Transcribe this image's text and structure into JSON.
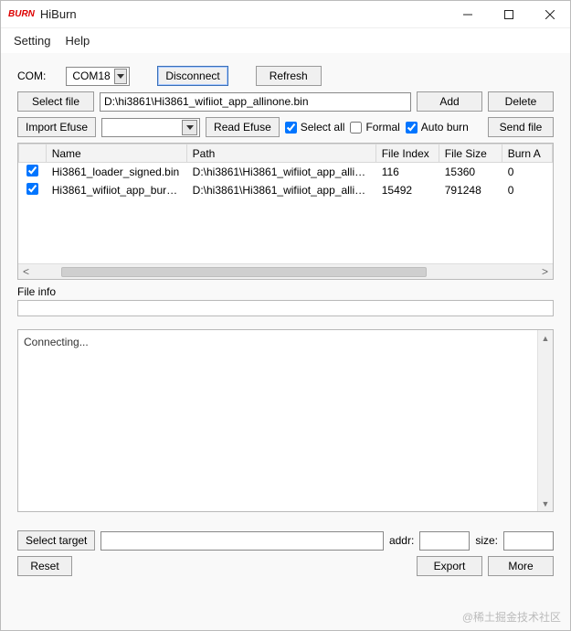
{
  "window": {
    "logo_text": "BURN",
    "title": "HiBurn"
  },
  "menu": {
    "setting": "Setting",
    "help": "Help"
  },
  "com": {
    "label": "COM:",
    "value": "COM18"
  },
  "buttons": {
    "disconnect": "Disconnect",
    "refresh": "Refresh",
    "select_file": "Select file",
    "add": "Add",
    "delete": "Delete",
    "import_efuse": "Import Efuse",
    "read_efuse": "Read Efuse",
    "send_file": "Send file",
    "select_target": "Select target",
    "reset": "Reset",
    "export": "Export",
    "more": "More"
  },
  "file_path": "D:\\hi3861\\Hi3861_wifiiot_app_allinone.bin",
  "checks": {
    "select_all": {
      "label": "Select all",
      "checked": true
    },
    "formal": {
      "label": "Formal",
      "checked": false
    },
    "auto_burn": {
      "label": "Auto burn",
      "checked": true
    }
  },
  "efuse_value": "",
  "table": {
    "headers": {
      "check": "",
      "name": "Name",
      "path": "Path",
      "file_index": "File Index",
      "file_size": "File Size",
      "burn_addr": "Burn A"
    },
    "rows": [
      {
        "checked": true,
        "name": "Hi3861_loader_signed.bin",
        "path": "D:\\hi3861\\Hi3861_wifiiot_app_allinon...",
        "file_index": "116",
        "file_size": "15360",
        "burn_addr": "0"
      },
      {
        "checked": true,
        "name": "Hi3861_wifiiot_app_burn...",
        "path": "D:\\hi3861\\Hi3861_wifiiot_app_allinon...",
        "file_index": "15492",
        "file_size": "791248",
        "burn_addr": "0"
      }
    ]
  },
  "file_info_label": "File info",
  "console_text": "Connecting...",
  "bottom": {
    "target_value": "",
    "addr_label": "addr:",
    "addr_value": "",
    "size_label": "size:",
    "size_value": ""
  },
  "watermark": "@稀土掘金技术社区"
}
